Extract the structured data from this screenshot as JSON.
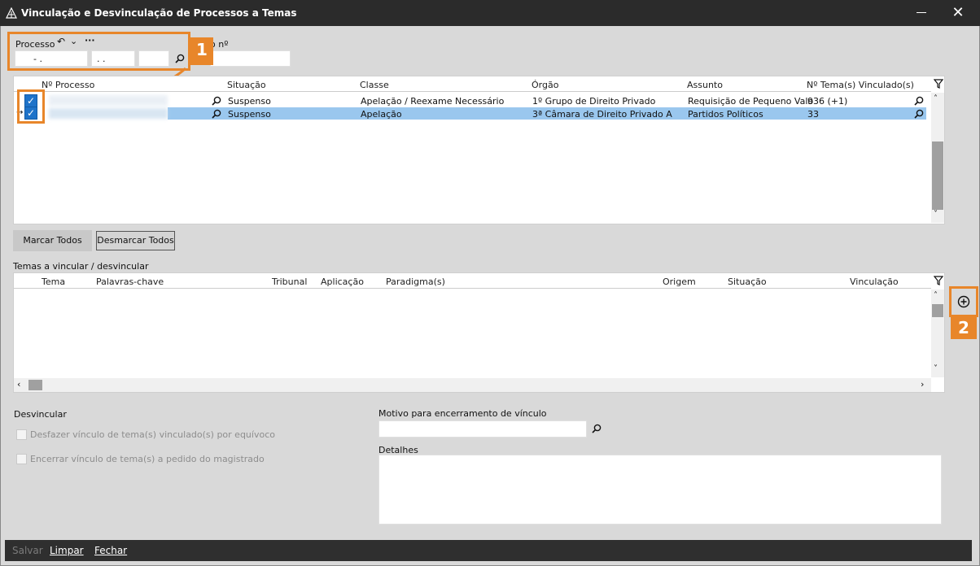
{
  "window": {
    "title": "Vinculação e Desvinculação de Processos a Temas"
  },
  "processo": {
    "label": "Processo",
    "field1": "- .",
    "field2": ". .",
    "field3": "",
    "extra_label": "o nº",
    "extra_value": ""
  },
  "top_grid": {
    "headers": [
      "Nº Processo",
      "Situação",
      "Classe",
      "Órgão",
      "Assunto",
      "Nº Tema(s) Vinculado(s)"
    ],
    "rows": [
      {
        "situacao": "Suspenso",
        "classe": "Apelação / Reexame Necessário",
        "orgao": "1º Grupo de Direito Privado",
        "assunto": "Requisição de Pequeno Valo",
        "temas": "936 (+1)"
      },
      {
        "situacao": "Suspenso",
        "classe": "Apelação",
        "orgao": "3ª Câmara de Direito Privado A",
        "assunto": "Partidos Políticos",
        "temas": "33"
      }
    ]
  },
  "buttons": {
    "marcar": "Marcar Todos",
    "desmarcar": "Desmarcar Todos"
  },
  "temas": {
    "section_label": "Temas a vincular / desvincular",
    "headers": [
      "Tema",
      "Palavras-chave",
      "Tribunal",
      "Aplicação",
      "Paradigma(s)",
      "Origem",
      "Situação",
      "Vinculação"
    ]
  },
  "desvincular": {
    "label": "Desvincular",
    "option1": "Desfazer vínculo de tema(s) vinculado(s) por equívoco",
    "option2": "Encerrar vínculo de tema(s) a pedido do magistrado"
  },
  "motivo": {
    "label": "Motivo para encerramento de vínculo",
    "value": ""
  },
  "detalhes": {
    "label": "Detalhes",
    "value": ""
  },
  "annotations": {
    "badge1": "1",
    "badge2": "2"
  },
  "footer": {
    "salvar": "Salvar",
    "limpar": "Limpar",
    "fechar": "Fechar"
  },
  "colors": {
    "accent": "#e8862a",
    "selected_row": "#9ac7ee",
    "check": "#1e73c9",
    "titlebar": "#2b2b2b"
  }
}
